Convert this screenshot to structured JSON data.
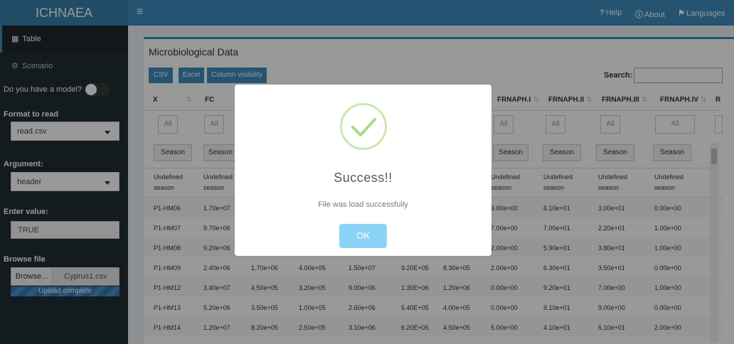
{
  "app": {
    "title": "ICHNAEA"
  },
  "topnav": {
    "menu_icon": "hamburger-icon",
    "help": "Help",
    "about": "About",
    "languages": "Languages"
  },
  "sidebar": {
    "menu": [
      {
        "label": "Table",
        "icon": "table-icon"
      },
      {
        "label": "Scenario",
        "icon": "cogs-icon"
      }
    ],
    "model_question": "Do you have a model?",
    "format_label": "Format to read",
    "format_value": "read.csv",
    "argument_label": "Argument:",
    "argument_value": "header",
    "enter_value_label": "Enter value:",
    "enter_value": "TRUE",
    "browse_label": "Browse file",
    "browse_button": "Browse...",
    "file_name": "Cyprus1.csv",
    "upload_status": "Upload complete"
  },
  "main": {
    "box_title": "Microbiological Data",
    "buttons": [
      "CSV",
      "Excel",
      "Column visibility"
    ],
    "search_label": "Search:",
    "columns": [
      "X",
      "FC",
      "",
      "",
      "",
      "",
      "",
      "FRNAPH.I",
      "FRNAPH.II",
      "FRNAPH.III",
      "FRNAPH.IV",
      "R"
    ],
    "filter_placeholder": "All",
    "season_button": "Season",
    "season_values": [
      "Undefined season",
      "Undefined season",
      "",
      "",
      "",
      "",
      "",
      "Undefined season",
      "Undefined season",
      "Undefined season",
      "Undefined season"
    ],
    "rows": [
      [
        "P1-HM06",
        "1.70e+07",
        "",
        "",
        "",
        "",
        "",
        "9.00e+00",
        "6.10e+01",
        "3.00e+01",
        "0.00e+00"
      ],
      [
        "P1-HM07",
        "9.70e+06",
        "",
        "",
        "",
        "",
        "",
        "7.00e+00",
        "7.00e+01",
        "2.20e+01",
        "1.00e+00"
      ],
      [
        "P1-HM08",
        "9.20e+06",
        "",
        "",
        "",
        "",
        "",
        "2.00e+00",
        "5.90e+01",
        "3.80e+01",
        "1.00e+00"
      ],
      [
        "P1-HM09",
        "2.40e+06",
        "1.70e+06",
        "4.00e+05",
        "1.50e+07",
        "9.20E+05",
        "8.30e+05",
        "2.00e+00",
        "6.30e+01",
        "3.50e+01",
        "0.00e+00"
      ],
      [
        "P1-HM12",
        "3.40e+07",
        "4.50e+05",
        "3.20e+05",
        "9.00e+06",
        "1.30E+06",
        "1.20e+06",
        "0.00e+00",
        "9.20e+01",
        "7.00e+00",
        "1.00e+00"
      ],
      [
        "P1-HM13",
        "5.20e+06",
        "3.50e+05",
        "1.00e+05",
        "2.60e+06",
        "5.40E+05",
        "4.00e+05",
        "0.00e+00",
        "9.10e+01",
        "9.00e+00",
        "0.00e+00"
      ],
      [
        "P1-HM14",
        "1.20e+07",
        "8.20e+05",
        "2.50e+05",
        "3.10e+06",
        "6.20E+05",
        "4.50e+05",
        "5.00e+00",
        "4.10e+01",
        "5.10e+01",
        "2.00e+00"
      ]
    ]
  },
  "modal": {
    "icon": "checkmark-icon",
    "title": "Success!!",
    "message": "File was load successfully",
    "ok": "OK"
  },
  "colors": {
    "header": "#3c8dbc",
    "logo": "#367fa9",
    "sidebar": "#222d32",
    "success": "#a5dc86",
    "ok_button": "#8cd4f5"
  }
}
